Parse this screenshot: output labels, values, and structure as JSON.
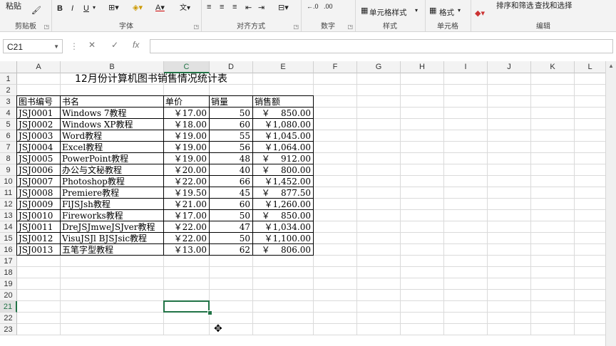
{
  "ribbon": {
    "clipboard": {
      "label": "剪贴板",
      "paste": "粘贴"
    },
    "font": {
      "label": "字体",
      "bold": "B",
      "italic": "I",
      "underline": "U"
    },
    "alignment": {
      "label": "对齐方式"
    },
    "number": {
      "label": "数字"
    },
    "styles": {
      "label": "样式",
      "cell_styles": "单元格样式"
    },
    "cells": {
      "label": "单元格",
      "format": "格式"
    },
    "editing": {
      "label": "编辑",
      "sort_filter": "排序和筛选",
      "find_select": "查找和选择"
    }
  },
  "formula_bar": {
    "name_box": "C21",
    "fx": "fx",
    "cancel": "✕",
    "confirm": "✓",
    "formula": ""
  },
  "columns": [
    "A",
    "B",
    "C",
    "D",
    "E",
    "F",
    "G",
    "H",
    "I",
    "J",
    "K",
    "L"
  ],
  "rows": [
    "1",
    "2",
    "3",
    "4",
    "5",
    "6",
    "7",
    "8",
    "9",
    "10",
    "11",
    "12",
    "13",
    "14",
    "15",
    "16",
    "17",
    "18",
    "19",
    "20",
    "21",
    "22",
    "23"
  ],
  "selected_cell": {
    "col": "C",
    "row": "21"
  },
  "sheet": {
    "title": "12月份计算机图书销售情况统计表",
    "headers": [
      "图书编号",
      "书名",
      "单价",
      "销量",
      "销售额"
    ],
    "data": [
      [
        "JSJ0001",
        "Windows 7教程",
        "￥17.00",
        "50",
        "￥    850.00"
      ],
      [
        "JSJ0002",
        "Windows XP教程",
        "￥18.00",
        "60",
        "￥1,080.00"
      ],
      [
        "JSJ0003",
        "Word教程",
        "￥19.00",
        "55",
        "￥1,045.00"
      ],
      [
        "JSJ0004",
        "Excel教程",
        "￥19.00",
        "56",
        "￥1,064.00"
      ],
      [
        "JSJ0005",
        "PowerPoint教程",
        "￥19.00",
        "48",
        "￥    912.00"
      ],
      [
        "JSJ0006",
        "办公与文秘教程",
        "￥20.00",
        "40",
        "￥    800.00"
      ],
      [
        "JSJ0007",
        "Photoshop教程",
        "￥22.00",
        "66",
        "￥1,452.00"
      ],
      [
        "JSJ0008",
        "Premiere教程",
        "￥19.50",
        "45",
        "￥    877.50"
      ],
      [
        "JSJ0009",
        "FlJSJsh教程",
        "￥21.00",
        "60",
        "￥1,260.00"
      ],
      [
        "JSJ0010",
        "Fireworks教程",
        "￥17.00",
        "50",
        "￥    850.00"
      ],
      [
        "JSJ0011",
        "DreJSJmweJSJver教程",
        "￥22.00",
        "47",
        "￥1,034.00"
      ],
      [
        "JSJ0012",
        "VisuJSJl BJSJsic教程",
        "￥22.00",
        "50",
        "￥1,100.00"
      ],
      [
        "JSJ0013",
        "五笔字型教程",
        "￥13.00",
        "62",
        "￥    806.00"
      ]
    ]
  },
  "colors": {
    "accent": "#217346",
    "header_bg": "#f3f3f3",
    "gridline": "#dadada"
  }
}
